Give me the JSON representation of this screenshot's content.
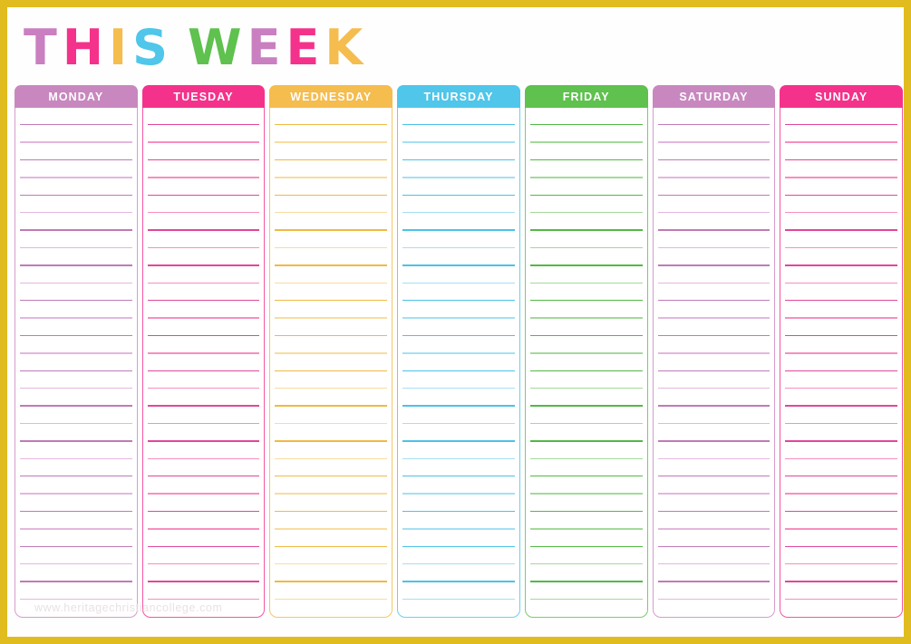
{
  "page": {
    "border_color": "#e0bc1e",
    "background": "#ffffff",
    "watermark": "www.heritagechristiancollege.com"
  },
  "title": {
    "text": "THIS WEEK",
    "letters": [
      {
        "char": "T",
        "color": "#c97fc0"
      },
      {
        "char": "H",
        "color": "#f4328b"
      },
      {
        "char": "I",
        "color": "#f5bc4e"
      },
      {
        "char": "S",
        "color": "#4fc6ea"
      },
      {
        "char": " ",
        "color": "transparent"
      },
      {
        "char": "W",
        "color": "#5fc14e"
      },
      {
        "char": "E",
        "color": "#c97fc0"
      },
      {
        "char": "E",
        "color": "#f4328b"
      },
      {
        "char": "K",
        "color": "#f5bc4e"
      }
    ]
  },
  "planner": {
    "line_count": 28,
    "columns": [
      {
        "id": "monday",
        "label": "MONDAY",
        "header_color": "#c888bf",
        "border_color": "#d79ccd",
        "rule_dark": "#c07ab7",
        "rule_light": "#e3b7de"
      },
      {
        "id": "tuesday",
        "label": "TUESDAY",
        "header_color": "#f4328b",
        "border_color": "#f5559f",
        "rule_dark": "#e0479a",
        "rule_light": "#f78fbe"
      },
      {
        "id": "wednesday",
        "label": "WEDNESDAY",
        "header_color": "#f5bc4e",
        "border_color": "#f6c766",
        "rule_dark": "#f0b945",
        "rule_light": "#f9dca0"
      },
      {
        "id": "thursday",
        "label": "THURSDAY",
        "header_color": "#4fc6ea",
        "border_color": "#6ed0ec",
        "rule_dark": "#4cc2e8",
        "rule_light": "#a5e0f3"
      },
      {
        "id": "friday",
        "label": "FRIDAY",
        "header_color": "#5fc14e",
        "border_color": "#7ccb6c",
        "rule_dark": "#53b846",
        "rule_light": "#a3d99a"
      },
      {
        "id": "saturday",
        "label": "SATURDAY",
        "header_color": "#c888bf",
        "border_color": "#d79ccd",
        "rule_dark": "#c07ab7",
        "rule_light": "#e3b7de"
      },
      {
        "id": "sunday",
        "label": "SUNDAY",
        "header_color": "#f4328b",
        "border_color": "#f5559f",
        "rule_dark": "#e0479a",
        "rule_light": "#f78fbe"
      }
    ]
  }
}
